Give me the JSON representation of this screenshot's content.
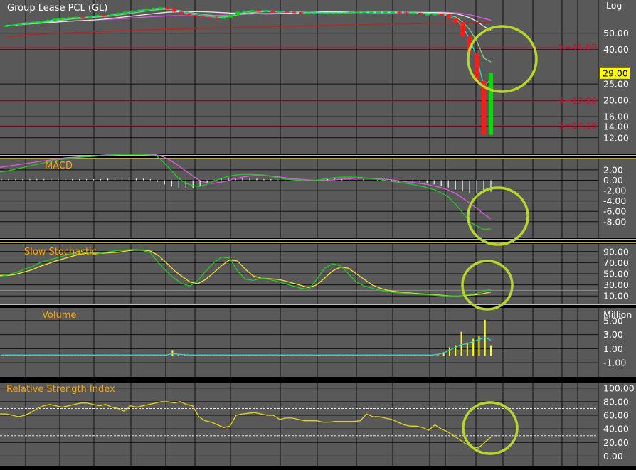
{
  "colors": {
    "background": "#000000",
    "panel": "#595959",
    "grid": "#0f0f0f",
    "axis_text": "#ffffff",
    "title": "#ffa500",
    "up_candle": "#00dd00",
    "down_candle": "#ff1a1a",
    "price_tag_bg": "#ffff00",
    "level_line": "#c8102e",
    "highlight_circle": "#b5d62c",
    "ma_cyan": "#35d6d6",
    "ma_green": "#7fd17f",
    "ma_white": "#e6e6e6",
    "ma_magenta": "#e05ae0",
    "ma_red": "#c02020",
    "stoch_green": "#22cc22",
    "stoch_yellow": "#f2e22c",
    "volume_bar": "#ffff00",
    "volume_ma": "#35d6d6",
    "rsi_line": "#e5d51a",
    "panel_separator": "#c9a227"
  },
  "chart_data": [
    {
      "panel": "price",
      "type": "candlestick",
      "title": "Group Lease PCL (GL)",
      "scale": "log",
      "scale_label": "Log",
      "yticks": [
        12,
        14,
        16,
        20,
        25,
        40,
        50
      ],
      "ytick_labels": [
        "12.00",
        "14.00",
        "16.00",
        "20.00",
        "25.00",
        "40.00",
        "50.00"
      ],
      "ylim": [
        11.3,
        70
      ],
      "last_price": 29.0,
      "last_price_label": "29.00",
      "levels": [
        {
          "label": "1=41.07",
          "value": 41.07
        },
        {
          "label": "3=19.80",
          "value": 19.8
        },
        {
          "label": "2=14.15",
          "value": 14.15
        }
      ],
      "closes": [
        55.5,
        56,
        57,
        58,
        58.5,
        59,
        60,
        61,
        61.5,
        62,
        62.5,
        62,
        63,
        64,
        63.5,
        64.5,
        66,
        67,
        68,
        69,
        70,
        70.5,
        71,
        70.5,
        67,
        65,
        64,
        63,
        62.5,
        62,
        61.5,
        62,
        64,
        67,
        68,
        68.5,
        68,
        68,
        67.5,
        67.5,
        67,
        66.5,
        66,
        66,
        66,
        66,
        66,
        66,
        66,
        66.5,
        67,
        67,
        67,
        67,
        67,
        67,
        66.5,
        66,
        66,
        65,
        65,
        65,
        64.5,
        61,
        58,
        48,
        38,
        26,
        12.5,
        29
      ]
    },
    {
      "panel": "macd",
      "type": "line",
      "title": "MACD",
      "yticks": [
        2,
        0,
        -2,
        -4,
        -6,
        -8
      ],
      "ytick_labels": [
        "2.00",
        "0.00",
        "-2.00",
        "-4.00",
        "-6.00",
        "-8.00"
      ],
      "ylim": [
        -10.5,
        3.5
      ],
      "macd": [
        1.6,
        1.8,
        2.1,
        2.4,
        2.7,
        3,
        3.3,
        3.6,
        3.9,
        4.1,
        4.3,
        4.4,
        4.5,
        4.6,
        4.7,
        4.8,
        4.9,
        5,
        5,
        5,
        5,
        4.9,
        4.7,
        3.5,
        2,
        0.5,
        -0.5,
        -1,
        -1.2,
        -0.8,
        -0.2,
        0.3,
        0.7,
        1,
        1.1,
        1.1,
        1.1,
        1,
        0.8,
        0.5,
        0.3,
        0.1,
        0,
        -0.1,
        -0.1,
        0.1,
        0.3,
        0.5,
        0.6,
        0.6,
        0.6,
        0.5,
        0.4,
        0.2,
        0,
        -0.2,
        -0.4,
        -0.6,
        -0.8,
        -1.1,
        -1.4,
        -1.8,
        -2.4,
        -3.2,
        -4.6,
        -6.2,
        -8,
        -8.8,
        -9.5,
        -9.4
      ],
      "signal": [
        2.5,
        2.7,
        2.9,
        3.1,
        3.3,
        3.5,
        3.7,
        3.9,
        4.1,
        4.3,
        4.4,
        4.5,
        4.6,
        4.7,
        4.8,
        4.9,
        4.9,
        5,
        5,
        5,
        5,
        5,
        4.9,
        4.5,
        3.8,
        2.9,
        1.9,
        0.9,
        0,
        -0.5,
        -0.6,
        -0.4,
        -0.1,
        0.3,
        0.6,
        0.8,
        0.9,
        0.9,
        0.8,
        0.7,
        0.5,
        0.3,
        0.2,
        0.1,
        0,
        0,
        0,
        0.1,
        0.2,
        0.3,
        0.4,
        0.4,
        0.4,
        0.3,
        0.2,
        0.1,
        -0.1,
        -0.3,
        -0.4,
        -0.6,
        -0.8,
        -1.1,
        -1.4,
        -1.9,
        -2.5,
        -3.4,
        -4.4,
        -5.4,
        -6.5,
        -7.5
      ],
      "histogram": [
        0.2,
        0.2,
        0.2,
        0.2,
        0.2,
        0.2,
        0.2,
        0.2,
        0.2,
        0.2,
        0.2,
        0.2,
        0.2,
        0.2,
        0.2,
        0.3,
        0.3,
        0.3,
        0.3,
        0.3,
        0.3,
        0.2,
        -0.3,
        -0.8,
        -1.2,
        -1.5,
        -1.6,
        -1.5,
        -1.2,
        -0.6,
        0.1,
        0.4,
        0.5,
        0.5,
        0.4,
        0.3,
        0.3,
        0.2,
        0.2,
        0.1,
        0.1,
        0,
        -0.1,
        -0.1,
        0,
        0.1,
        0.2,
        0.3,
        0.3,
        0.3,
        0.2,
        0.1,
        0,
        -0.1,
        -0.2,
        -0.2,
        -0.3,
        -0.3,
        -0.4,
        -0.5,
        -0.6,
        -0.8,
        -1.1,
        -1.4,
        -1.8,
        -2.1,
        -2.4,
        -2.5,
        -2.4,
        -2.2
      ]
    },
    {
      "panel": "stochastic",
      "type": "line",
      "title": "Slow Stochastic",
      "yticks": [
        90,
        70,
        50,
        30,
        10
      ],
      "ytick_labels": [
        "90.00",
        "70.00",
        "50.00",
        "30.00",
        "10.00"
      ],
      "ylim": [
        0,
        100
      ],
      "k": [
        45,
        48,
        52,
        58,
        62,
        70,
        74,
        78,
        82,
        86,
        90,
        88,
        85,
        88,
        90,
        92,
        93,
        94,
        92,
        88,
        70,
        55,
        42,
        32,
        28,
        38,
        55,
        70,
        80,
        78,
        55,
        40,
        38,
        42,
        40,
        36,
        32,
        28,
        24,
        22,
        40,
        60,
        68,
        65,
        50,
        35,
        28,
        24,
        20,
        18,
        16,
        15,
        14,
        13,
        12,
        11,
        10,
        10,
        10,
        12,
        14,
        18,
        22
      ],
      "d": [
        47,
        47,
        49,
        53,
        57,
        63,
        68,
        73,
        77,
        81,
        85,
        87,
        87,
        87,
        88,
        89,
        91,
        93,
        93,
        91,
        83,
        70,
        56,
        45,
        35,
        32,
        40,
        52,
        65,
        75,
        73,
        58,
        46,
        42,
        41,
        40,
        37,
        33,
        29,
        25,
        30,
        42,
        55,
        62,
        60,
        50,
        40,
        30,
        24,
        20,
        18,
        16,
        15,
        14,
        13,
        12,
        11,
        10,
        10,
        11,
        12,
        14,
        17
      ]
    },
    {
      "panel": "volume",
      "type": "bar",
      "title": "Volume",
      "unit_label": "Million",
      "yticks": [
        5,
        3,
        1,
        -1
      ],
      "ytick_labels": [
        "5.00",
        "3.00",
        "1.00",
        "-1.00"
      ],
      "ylim": [
        -2.5,
        6.5
      ],
      "values": [
        0.1,
        0.1,
        0.1,
        0.1,
        0.1,
        0.1,
        0.1,
        0.1,
        0.1,
        0.1,
        0.1,
        0.1,
        0.1,
        0.1,
        0.1,
        0.1,
        0.1,
        0.1,
        0.1,
        0.1,
        0.1,
        0.1,
        0.1,
        0.1,
        0.1,
        0.1,
        0.1,
        0.1,
        0.1,
        0.8,
        0.1,
        0.1,
        0.1,
        0.1,
        0.1,
        0.1,
        0.1,
        0.1,
        0.1,
        0.1,
        0.1,
        0.1,
        0.1,
        0.1,
        0.1,
        0.1,
        0.1,
        0.1,
        0.1,
        0.1,
        0.1,
        0.1,
        0.1,
        0.1,
        0.1,
        0.1,
        0.1,
        0.1,
        0.1,
        0.1,
        0.1,
        0.1,
        0.1,
        0.1,
        0.1,
        0.1,
        0.1,
        0.1,
        0.1,
        0.1,
        0.1,
        0.1,
        0.1,
        0.1,
        0.2,
        0.5,
        1.2,
        1.5,
        3.4,
        1.9,
        2.4,
        2.8,
        5.1,
        1.5
      ],
      "ma": [
        0.1,
        0.1,
        0.1,
        0.1,
        0.1,
        0.1,
        0.1,
        0.1,
        0.1,
        0.1,
        0.1,
        0.1,
        0.1,
        0.1,
        0.1,
        0.1,
        0.1,
        0.1,
        0.1,
        0.1,
        0.1,
        0.1,
        0.1,
        0.1,
        0.1,
        0.1,
        0.1,
        0.1,
        0.1,
        0.3,
        0.2,
        0.15,
        0.1,
        0.1,
        0.1,
        0.1,
        0.1,
        0.1,
        0.1,
        0.1,
        0.1,
        0.1,
        0.1,
        0.1,
        0.1,
        0.1,
        0.1,
        0.1,
        0.1,
        0.1,
        0.1,
        0.1,
        0.1,
        0.1,
        0.1,
        0.1,
        0.1,
        0.1,
        0.1,
        0.1,
        0.1,
        0.1,
        0.1,
        0.1,
        0.1,
        0.1,
        0.1,
        0.1,
        0.1,
        0.1,
        0.1,
        0.1,
        0.1,
        0.1,
        0.2,
        0.4,
        0.8,
        1.2,
        1.6,
        1.7,
        2,
        2.3,
        2.6,
        2.2
      ]
    },
    {
      "panel": "rsi",
      "type": "line",
      "title": "Relative Strength Index",
      "yticks": [
        100,
        80,
        60,
        40,
        20,
        0
      ],
      "ytick_labels": [
        "100.00",
        "80.00",
        "60.00",
        "40.00",
        "20.00",
        "0.00"
      ],
      "ylim": [
        -10,
        105
      ],
      "reference_lines": [
        70,
        30
      ],
      "values": [
        62,
        62,
        60,
        58,
        60,
        64,
        70,
        74,
        76,
        74,
        72,
        74,
        76,
        78,
        78,
        76,
        74,
        76,
        72,
        70,
        66,
        74,
        72,
        74,
        76,
        78,
        80,
        80,
        78,
        80,
        76,
        74,
        58,
        52,
        50,
        46,
        42,
        44,
        60,
        62,
        63,
        64,
        62,
        60,
        60,
        54,
        56,
        56,
        54,
        52,
        52,
        52,
        50,
        50,
        51,
        51,
        51,
        51,
        52,
        62,
        58,
        58,
        56,
        54,
        50,
        46,
        44,
        44,
        42,
        38,
        46,
        40,
        36,
        30,
        24,
        18,
        14,
        12,
        20,
        28
      ]
    }
  ]
}
